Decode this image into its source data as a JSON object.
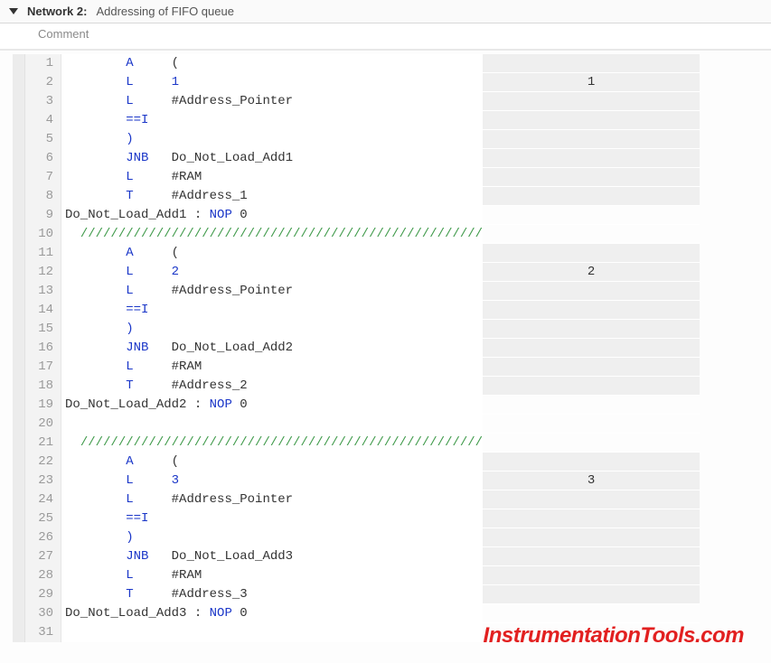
{
  "header": {
    "network_label": "Network 2:",
    "network_title": "Addressing of FIFO queue"
  },
  "comment_placeholder": "Comment",
  "watermark": "InstrumentationTools.com",
  "lines": [
    {
      "n": 1,
      "indent": 8,
      "op": "A",
      "arg": "("
    },
    {
      "n": 2,
      "indent": 8,
      "op": "L",
      "arg": "1",
      "argIsKw": true,
      "value": "1"
    },
    {
      "n": 3,
      "indent": 8,
      "op": "L",
      "arg": "#Address_Pointer"
    },
    {
      "n": 4,
      "indent": 8,
      "op": "==I"
    },
    {
      "n": 5,
      "indent": 8,
      "op": ")"
    },
    {
      "n": 6,
      "indent": 8,
      "op": "JNB",
      "arg": "Do_Not_Load_Add1"
    },
    {
      "n": 7,
      "indent": 8,
      "op": "L",
      "arg": "#RAM"
    },
    {
      "n": 8,
      "indent": 8,
      "op": "T",
      "arg": "#Address_1"
    },
    {
      "n": 9,
      "raw_label": "Do_Not_Load_Add1",
      "raw_nop": "NOP",
      "raw_zero": "0"
    },
    {
      "n": 10,
      "sep": "/////////////////////////////////////////////////////"
    },
    {
      "n": 11,
      "indent": 8,
      "op": "A",
      "arg": "("
    },
    {
      "n": 12,
      "indent": 8,
      "op": "L",
      "arg": "2",
      "argIsKw": true,
      "value": "2"
    },
    {
      "n": 13,
      "indent": 8,
      "op": "L",
      "arg": "#Address_Pointer"
    },
    {
      "n": 14,
      "indent": 8,
      "op": "==I"
    },
    {
      "n": 15,
      "indent": 8,
      "op": ")"
    },
    {
      "n": 16,
      "indent": 8,
      "op": "JNB",
      "arg": "Do_Not_Load_Add2"
    },
    {
      "n": 17,
      "indent": 8,
      "op": "L",
      "arg": "#RAM"
    },
    {
      "n": 18,
      "indent": 8,
      "op": "T",
      "arg": "#Address_2"
    },
    {
      "n": 19,
      "raw_label": "Do_Not_Load_Add2",
      "raw_nop": "NOP",
      "raw_zero": "0"
    },
    {
      "n": 20,
      "blank": true
    },
    {
      "n": 21,
      "sep": "/////////////////////////////////////////////////////"
    },
    {
      "n": 22,
      "indent": 8,
      "op": "A",
      "arg": "("
    },
    {
      "n": 23,
      "indent": 8,
      "op": "L",
      "arg": "3",
      "argIsKw": true,
      "value": "3"
    },
    {
      "n": 24,
      "indent": 8,
      "op": "L",
      "arg": "#Address_Pointer"
    },
    {
      "n": 25,
      "indent": 8,
      "op": "==I"
    },
    {
      "n": 26,
      "indent": 8,
      "op": ")"
    },
    {
      "n": 27,
      "indent": 8,
      "op": "JNB",
      "arg": "Do_Not_Load_Add3"
    },
    {
      "n": 28,
      "indent": 8,
      "op": "L",
      "arg": "#RAM"
    },
    {
      "n": 29,
      "indent": 8,
      "op": "T",
      "arg": "#Address_3"
    },
    {
      "n": 30,
      "raw_label": "Do_Not_Load_Add3",
      "raw_nop": "NOP",
      "raw_zero": "0"
    },
    {
      "n": 31,
      "blank": true
    }
  ]
}
